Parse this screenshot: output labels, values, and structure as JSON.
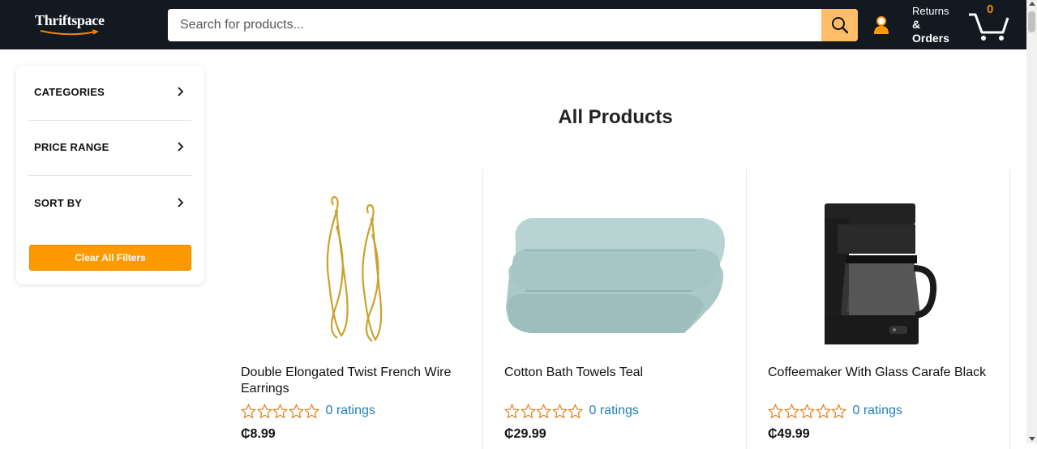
{
  "header": {
    "logo": "Thriftspace",
    "search_placeholder": "Search for products...",
    "returns_line1": "Returns",
    "returns_line2": "&",
    "returns_line3": "Orders",
    "cart_count": "0",
    "colors": {
      "bar": "#131921",
      "search_button": "#febd69",
      "cart_count": "#f08804"
    }
  },
  "filters": {
    "items": [
      {
        "label": "CATEGORIES",
        "icon": "chevron-right-icon"
      },
      {
        "label": "PRICE RANGE",
        "icon": "chevron-right-icon"
      },
      {
        "label": "SORT BY",
        "icon": "chevron-right-icon"
      }
    ],
    "clear_button": "Clear All Filters",
    "clear_button_color": "#ff9900"
  },
  "main": {
    "title": "All Products",
    "products": [
      {
        "name": "Double Elongated Twist French Wire Earrings",
        "ratings_text": "0 ratings",
        "rating": 0,
        "price": "₵8.99",
        "image_icon": "earrings-image"
      },
      {
        "name": "Cotton Bath Towels Teal",
        "ratings_text": "0 ratings",
        "rating": 0,
        "price": "₵29.99",
        "image_icon": "towels-image"
      },
      {
        "name": "Coffeemaker With Glass Carafe Black",
        "ratings_text": "0 ratings",
        "rating": 0,
        "price": "₵49.99",
        "image_icon": "coffeemaker-image"
      }
    ],
    "star_color": "#e47911",
    "link_color": "#1f7fb4"
  }
}
